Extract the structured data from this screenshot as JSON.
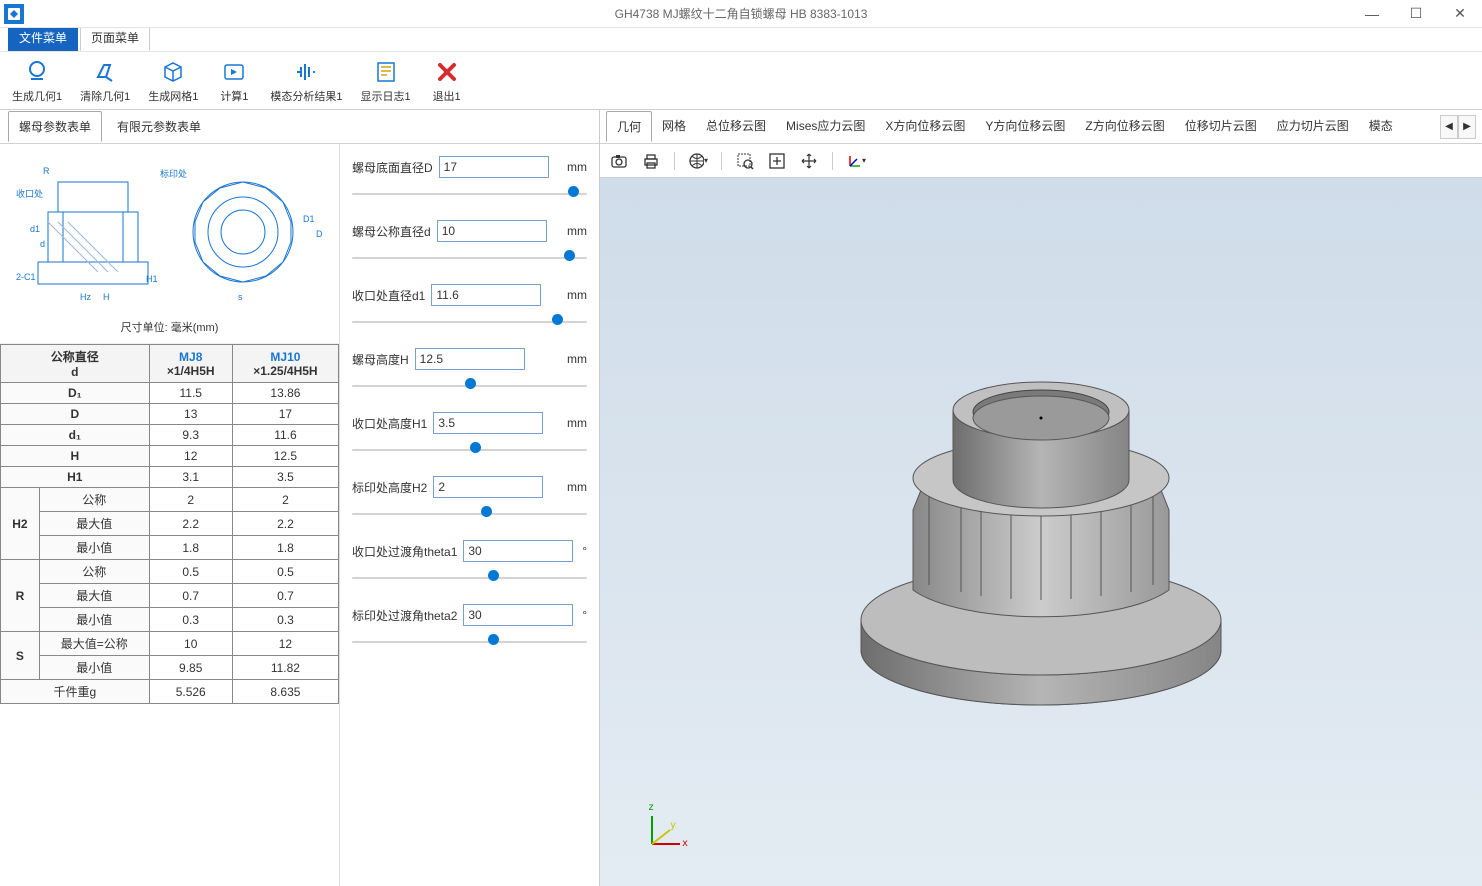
{
  "window": {
    "title": "GH4738 MJ螺纹十二角自锁螺母 HB 8383-1013"
  },
  "menu_tabs": {
    "file": "文件菜单",
    "page": "页面菜单"
  },
  "ribbon": {
    "gen_geo": "生成几何1",
    "clear_geo": "清除几何1",
    "gen_mesh": "生成网格1",
    "compute": "计算1",
    "modal_result": "模态分析结果1",
    "show_log": "显示日志1",
    "exit": "退出1"
  },
  "left_tabs": {
    "nut_params": "螺母参数表单",
    "fem_params": "有限元参数表单"
  },
  "schematic": {
    "R": "R",
    "label_mark": "标印处",
    "label_close": "收口处",
    "d1": "d1",
    "d": "d",
    "D1": "D1",
    "D": "D",
    "Hz": "Hz",
    "H": "H",
    "s": "s",
    "H1": "H1",
    "C1": "2-C1",
    "caption": "尺寸单位: 毫米(mm)"
  },
  "spec_table": {
    "headers": {
      "nominal": "公称直径",
      "d": "d",
      "mj8": "MJ8",
      "mj8_sub": "×1/4H5H",
      "mj10": "MJ10",
      "mj10_sub": "×1.25/4H5H"
    },
    "rows": [
      {
        "k": "D₁",
        "mj8": "11.5",
        "mj10": "13.86"
      },
      {
        "k": "D",
        "mj8": "13",
        "mj10": "17"
      },
      {
        "k": "d₁",
        "mj8": "9.3",
        "mj10": "11.6"
      },
      {
        "k": "H",
        "mj8": "12",
        "mj10": "12.5"
      },
      {
        "k": "H1",
        "mj8": "3.1",
        "mj10": "3.5"
      }
    ],
    "groups": [
      {
        "g": "H2",
        "sub": [
          {
            "k": "公称",
            "mj8": "2",
            "mj10": "2"
          },
          {
            "k": "最大值",
            "mj8": "2.2",
            "mj10": "2.2"
          },
          {
            "k": "最小值",
            "mj8": "1.8",
            "mj10": "1.8"
          }
        ]
      },
      {
        "g": "R",
        "sub": [
          {
            "k": "公称",
            "mj8": "0.5",
            "mj10": "0.5"
          },
          {
            "k": "最大值",
            "mj8": "0.7",
            "mj10": "0.7"
          },
          {
            "k": "最小值",
            "mj8": "0.3",
            "mj10": "0.3"
          }
        ]
      },
      {
        "g": "S",
        "sub": [
          {
            "k": "最大值=公称",
            "mj8": "10",
            "mj10": "12"
          },
          {
            "k": "最小值",
            "mj8": "9.85",
            "mj10": "11.82"
          }
        ]
      }
    ],
    "footer": {
      "k": "千件重g",
      "mj8": "5.526",
      "mj10": "8.635"
    }
  },
  "params": [
    {
      "label": "螺母底面直径D",
      "value": "17",
      "unit": "mm",
      "pos": 92
    },
    {
      "label": "螺母公称直径d",
      "value": "10",
      "unit": "mm",
      "pos": 90
    },
    {
      "label": "收口处直径d1",
      "value": "11.6",
      "unit": "mm",
      "pos": 85
    },
    {
      "label": "螺母高度H",
      "value": "12.5",
      "unit": "mm",
      "pos": 48
    },
    {
      "label": "收口处高度H1",
      "value": "3.5",
      "unit": "mm",
      "pos": 50
    },
    {
      "label": "标印处高度H2",
      "value": "2",
      "unit": "mm",
      "pos": 55
    },
    {
      "label": "收口处过渡角theta1",
      "value": "30",
      "unit": "°",
      "pos": 58
    },
    {
      "label": "标印处过渡角theta2",
      "value": "30",
      "unit": "°",
      "pos": 58
    }
  ],
  "view_tabs": {
    "items": [
      "几何",
      "网格",
      "总位移云图",
      "Mises应力云图",
      "X方向位移云图",
      "Y方向位移云图",
      "Z方向位移云图",
      "位移切片云图",
      "应力切片云图",
      "模态"
    ]
  },
  "axis": {
    "z": "z",
    "y": "y",
    "x": "x"
  }
}
